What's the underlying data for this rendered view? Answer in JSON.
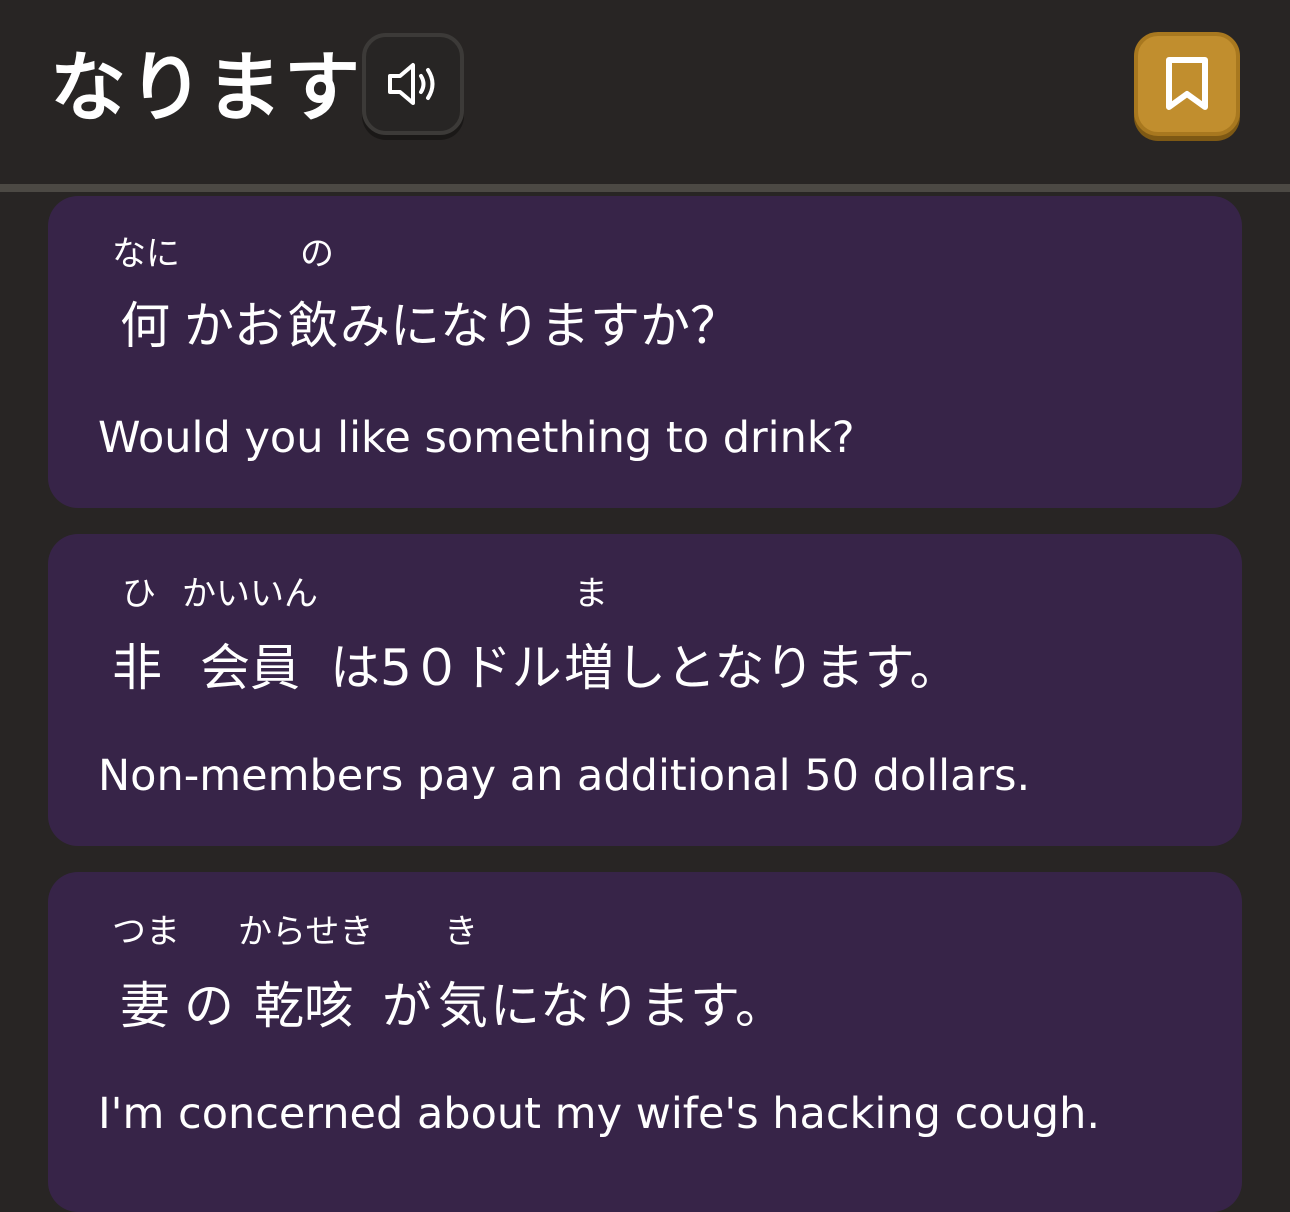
{
  "header": {
    "word": "なります",
    "sound_icon": "speaker-icon",
    "bookmark_icon": "bookmark-icon",
    "bookmark_color": "#c18e2e"
  },
  "examples": [
    {
      "furigana": [
        "なに",
        "の"
      ],
      "japanese": [
        "何",
        "かお",
        "飲",
        "みになりますか？"
      ],
      "english": "Would you like something to drink?"
    },
    {
      "furigana": [
        "ひ",
        "かいいん",
        "ま"
      ],
      "japanese": [
        "非",
        "会員",
        "は5０ドル",
        "増",
        "しとなります。"
      ],
      "english": "Non-members pay an additional 50 dollars."
    },
    {
      "furigana": [
        "つま",
        "からせき",
        "き"
      ],
      "japanese": [
        "妻",
        "の",
        "乾咳",
        "が",
        "気",
        "になります。"
      ],
      "english": "I'm concerned about my wife's hacking cough."
    }
  ],
  "colors": {
    "background": "#282524",
    "card": "#372448",
    "divider": "#4c4944"
  }
}
